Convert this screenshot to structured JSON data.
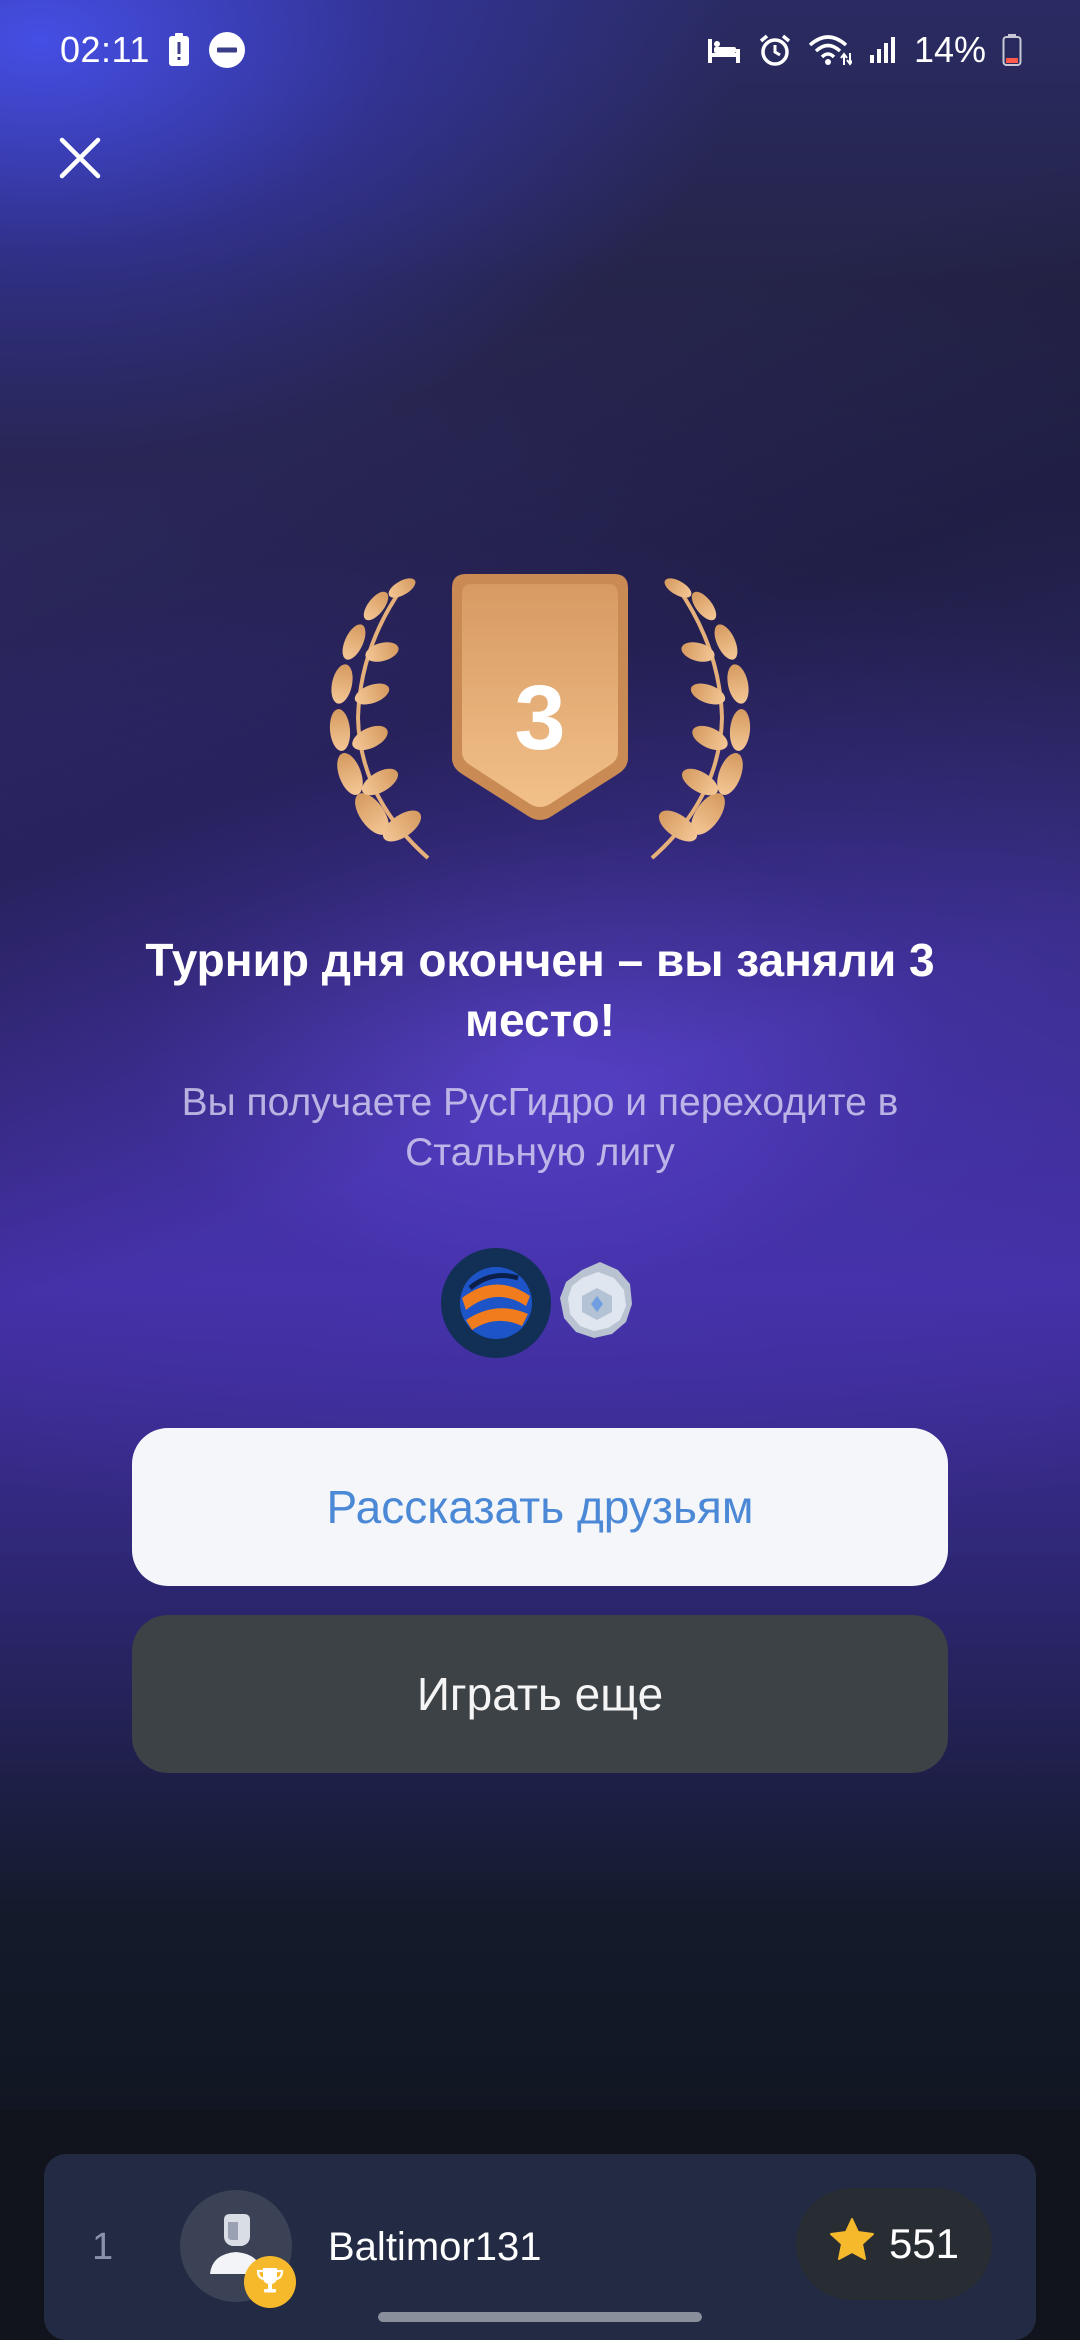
{
  "colors": {
    "accent_blue": "#4b88d6",
    "medal_bronze": "#e0a56a",
    "background_purple": "#4530a7",
    "star_yellow": "#f6b92b"
  },
  "status_bar": {
    "time": "02:11",
    "battery_percent": "14%",
    "left_icons": [
      "battery-alert-icon",
      "do-not-disturb-icon"
    ],
    "right_icons": [
      "sleep-mode-icon",
      "alarm-icon",
      "wifi-icon",
      "cellular-signal-icon",
      "battery-low-icon"
    ]
  },
  "header": {
    "close_icon": "close-icon"
  },
  "result": {
    "place": "3",
    "title": "Турнир дня окончен – вы заняли 3 место!",
    "subtitle": "Вы получаете РусГидро и переходите в Стальную лигу",
    "reward_icons": [
      "rushydro-logo-icon",
      "steel-league-badge-icon"
    ]
  },
  "actions": {
    "share_label": "Рассказать друзьям",
    "play_again_label": "Играть еще"
  },
  "leaderboard": {
    "rows": [
      {
        "rank": "1",
        "username": "Baltimor131",
        "score": "551",
        "avatar_icon": "user-avatar-icon",
        "badge_icon": "trophy-icon",
        "score_icon": "star-icon"
      }
    ]
  }
}
